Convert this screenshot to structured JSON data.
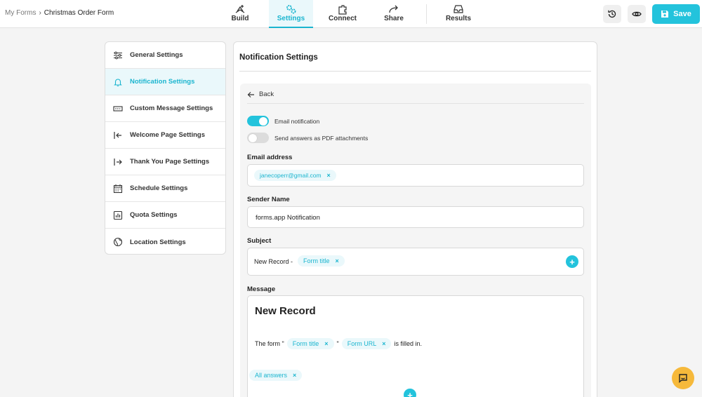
{
  "breadcrumb": {
    "root": "My Forms",
    "separator": "›",
    "current": "Christmas Order Form"
  },
  "tabs": [
    {
      "label": "Build",
      "icon": "build-icon"
    },
    {
      "label": "Settings",
      "icon": "settings-icon",
      "active": true
    },
    {
      "label": "Connect",
      "icon": "connect-icon"
    },
    {
      "label": "Share",
      "icon": "share-icon"
    },
    {
      "label": "Results",
      "icon": "results-icon"
    }
  ],
  "toolbar": {
    "save_label": "Save",
    "history_icon": "history-icon",
    "preview_icon": "eye-icon"
  },
  "sidebar": {
    "items": [
      {
        "label": "General Settings",
        "icon": "sliders-icon"
      },
      {
        "label": "Notification Settings",
        "icon": "bell-icon",
        "active": true
      },
      {
        "label": "Custom Message Settings",
        "icon": "message-icon"
      },
      {
        "label": "Welcome Page Settings",
        "icon": "enter-icon"
      },
      {
        "label": "Thank You Page Settings",
        "icon": "exit-icon"
      },
      {
        "label": "Schedule Settings",
        "icon": "calendar-icon"
      },
      {
        "label": "Quota Settings",
        "icon": "chart-icon"
      },
      {
        "label": "Location Settings",
        "icon": "globe-icon"
      }
    ]
  },
  "panel": {
    "title": "Notification Settings",
    "back_label": "Back",
    "email_notification": {
      "label": "Email notification",
      "on": true
    },
    "pdf_attachments": {
      "label": "Send answers as PDF attachments",
      "on": false
    },
    "email_address": {
      "label": "Email address",
      "chips": [
        "janecoperr@gmail.com"
      ]
    },
    "sender_name": {
      "label": "Sender Name",
      "value": "forms.app Notification"
    },
    "subject": {
      "label": "Subject",
      "prefix": "New Record -",
      "chips": [
        "Form title"
      ]
    },
    "message": {
      "label": "Message",
      "heading": "New Record",
      "line_prefix": "The form \"",
      "chip1": "Form title",
      "quote": "\"",
      "chip2": "Form URL",
      "line_suffix": "is filled in.",
      "answers_chip": "All answers"
    }
  },
  "colors": {
    "accent": "#23c3dc",
    "accent_text": "#1bb5cf",
    "accent_bg": "#eaf8fb",
    "chat": "#f6b93b"
  }
}
